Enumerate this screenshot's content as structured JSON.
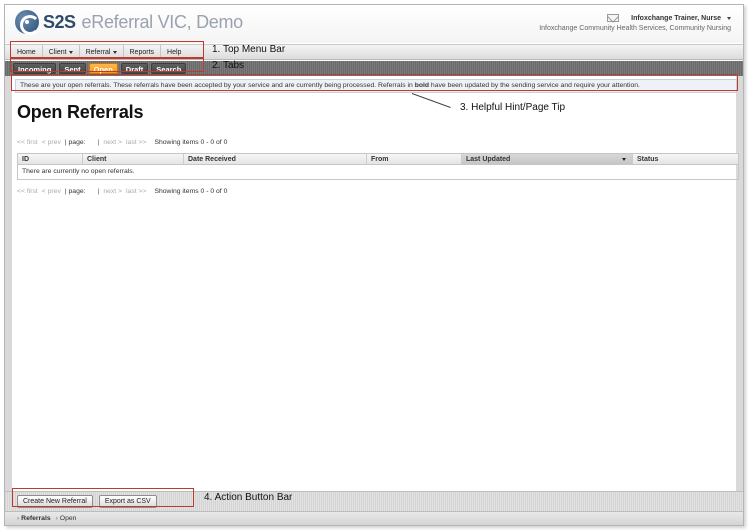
{
  "header": {
    "logo_brand": "S2S",
    "logo_rest": "eReferral VIC, Demo",
    "user_name": "Infoxchange Trainer, Nurse",
    "user_org": "Infoxchange Community Health Services, Community Nursing"
  },
  "menu": {
    "items": [
      {
        "label": "Home",
        "dropdown": false
      },
      {
        "label": "Client",
        "dropdown": true
      },
      {
        "label": "Referral",
        "dropdown": true
      },
      {
        "label": "Reports",
        "dropdown": false
      },
      {
        "label": "Help",
        "dropdown": false
      }
    ]
  },
  "tabs": {
    "items": [
      "Incoming",
      "Sent",
      "Open",
      "Draft",
      "Search"
    ],
    "active": "Open"
  },
  "hint": {
    "text_before": "These are your open referrals. These referrals have been accepted by your service and are currently being processed. Referrals in ",
    "bold_word": "bold",
    "text_after": " have been updated by the sending service and require your attention."
  },
  "page": {
    "title": "Open Referrals"
  },
  "pager": {
    "first": "<< first",
    "prev": "< prev",
    "page_label": "| page:",
    "sep": "|",
    "next": "next >",
    "last": "last >>",
    "showing": "Showing items 0 - 0 of 0"
  },
  "table": {
    "columns": [
      "ID",
      "Client",
      "Date Received",
      "From",
      "Last Updated",
      "Status"
    ],
    "sorted_column": "Last Updated",
    "empty_message": "There are currently no open referrals."
  },
  "actions": {
    "create": "Create New Referral",
    "export": "Export as CSV"
  },
  "breadcrumb": {
    "items": [
      "Referrals",
      "Open"
    ]
  },
  "annotations": {
    "top_menu": "1. Top Menu Bar",
    "tabs": "2. Tabs",
    "hint": "3. Helpful Hint/Page Tip",
    "action_bar": "4. Action Button Bar"
  },
  "colors": {
    "annotation": "#c0392b",
    "active_tab": "#f29a1c",
    "hint_bg": "#eef1f6",
    "logo": "#2f4a6b"
  }
}
